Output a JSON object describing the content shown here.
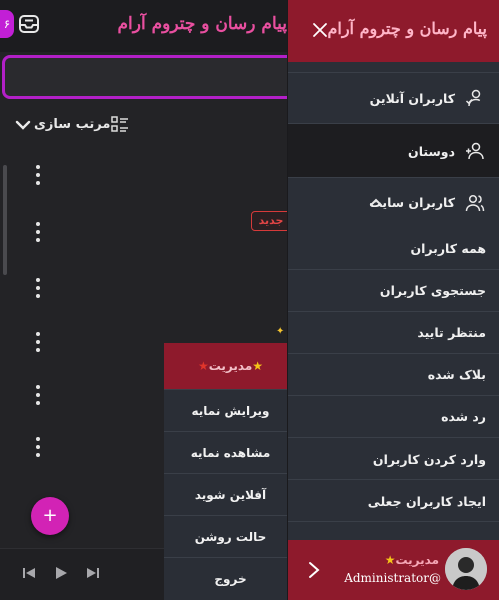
{
  "app": {
    "title": "پیام رسان و چتروم آرام",
    "notification_count": "۶",
    "sort_label": "مرتب سازی",
    "new_badge": "جدید",
    "fab_label": "+"
  },
  "context_menu": {
    "header": "مدیریت",
    "items": [
      "ویرایش نمایه",
      "مشاهده نمایه",
      "آفلاین شوید",
      "حالت روشن",
      "خروج"
    ]
  },
  "drawer": {
    "title": "پیام رسان و چتروم آرام",
    "online_users": "کاربران آنلاین",
    "friends": "دوستان",
    "site_users": "کاربران سایت",
    "sub_items": [
      "همه کاربران",
      "جستجوی کاربران",
      "منتظر تایید",
      "بلاک شده",
      "رد شده",
      "وارد کردن کاربران",
      "ایجاد کاربران جعلی"
    ],
    "footer": {
      "role": "مدیریت",
      "username": "Administrator@"
    }
  },
  "colors": {
    "accent_magenta": "#b320c8",
    "drawer_header": "#8e1a2c",
    "new_badge": "#d63a3a"
  },
  "icons": [
    "inbox-icon",
    "chevron-down-icon",
    "list-icon",
    "more-vertical-icon",
    "close-icon",
    "user-check-icon",
    "user-plus-icon",
    "users-icon",
    "chevron-up-icon",
    "chevron-right-icon",
    "star-icon",
    "skip-back-icon",
    "play-icon",
    "skip-forward-icon",
    "sparkle-icon"
  ]
}
